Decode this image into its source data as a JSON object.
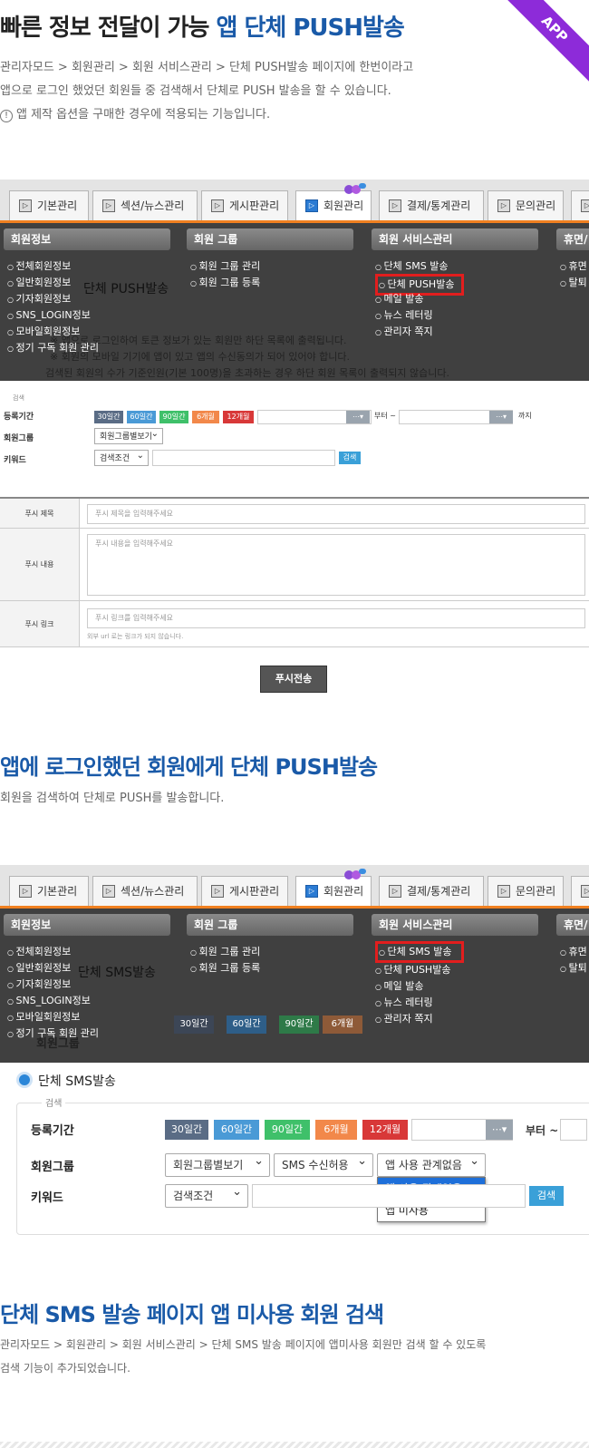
{
  "badge": "APP",
  "section1": {
    "title_plain": "빠른 정보 전달이 가능 ",
    "title_highlight": "앱 단체 PUSH발송",
    "desc_line1": "관리자모드 > 회원관리 > 회원 서비스관리 > 단체 PUSH발송 페이지에 한번이라고",
    "desc_line2": "앱으로 로그인 했었던 회원들 중 검색해서 단체로 PUSH 발송을 할 수 있습니다.",
    "notice_icon": "!",
    "desc_line3": "앱 제작 옵션을 구매한 경우에 적용되는 기능입니다."
  },
  "tabs": [
    "기본관리",
    "섹션/뉴스관리",
    "게시판관리",
    "회원관리",
    "결제/통계관리",
    "문의관리"
  ],
  "menu": {
    "group1": {
      "title": "회원정보",
      "items": [
        "전체회원정보",
        "일반회원정보",
        "기자회원정보",
        "SNS_LOGIN정보",
        "모바일회원정보",
        "정기 구독 회원 관리"
      ]
    },
    "group2": {
      "title": "회원 그룹",
      "items": [
        "회원 그룹 관리",
        "회원 그룹 등록"
      ]
    },
    "group3": {
      "title": "회원 서비스관리",
      "items": [
        "단체 SMS 발송",
        "단체 PUSH발송",
        "메일 발송",
        "뉴스 레터링",
        "관리자 쪽지"
      ]
    },
    "group4": {
      "title": "휴면/",
      "items": [
        "휴면",
        "탈퇴"
      ]
    }
  },
  "shot1": {
    "ghost_page_title": "단체 PUSH발송",
    "ghost_line1": "※ 앱으로 로그인하여 토큰 정보가 있는 회원만 하단 목록에 출력됩니다.",
    "ghost_line2": "※ 회원의 모바일 기기에 앱이 있고 앱의 수신동의가 되어 있어야 합니다.",
    "ghost_line3": "검색된 회원의 수가 기준인원(기본 100명)을 초과하는 경우 하단 회원 목록이 출력되지 않습니다.",
    "search": {
      "legend": "검색",
      "period_label": "등록기간",
      "periods": [
        "30일간",
        "60일간",
        "90일간",
        "6개월",
        "12개월"
      ],
      "from": "부터 ~",
      "to": "까지",
      "group_label": "회원그룹",
      "group_select": "회원그룹별보기",
      "keyword_label": "키워드",
      "keyword_select": "검색조건",
      "search_button": "검색"
    },
    "form": {
      "title_label": "푸시 제목",
      "title_placeholder": "푸시 제목을 입력해주세요",
      "content_label": "푸시 내용",
      "content_placeholder": "푸시 내용을 입력해주세요",
      "link_label": "푸시 링크",
      "link_placeholder": "푸시 링크를 입력해주세요",
      "link_note": "외부 url 로는 링크가 되지 않습니다."
    },
    "send_button": "푸시전송"
  },
  "section2": {
    "title": "앱에 로그인했던 회원에게 단체 PUSH발송",
    "desc": "회원을 검색하여 단체로 PUSH를 발송합니다."
  },
  "shot2": {
    "ghost_page_title": "단체 SMS발송",
    "page_title": "단체 SMS발송",
    "search": {
      "legend": "검색",
      "period_label": "등록기간",
      "periods": [
        "30일간",
        "60일간",
        "90일간",
        "6개월",
        "12개월"
      ],
      "from": "부터 ~",
      "group_label": "회원그룹",
      "group_select": "회원그룹별보기",
      "sms_select": "SMS 수신허용",
      "app_select": "앱 사용 관계없음",
      "app_options": [
        "앱 사용 관계없음",
        "앱 미사용"
      ],
      "keyword_label": "키워드",
      "keyword_select": "검색조건",
      "search_button": "검색"
    }
  },
  "section3": {
    "title": "단체 SMS 발송 페이지 앱 미사용 회원 검색",
    "desc_line1": "관리자모드 > 회원관리 > 회원 서비스관리 > 단체 SMS 발송 페이지에 앱미사용 회원만 검색 할 수 있도록",
    "desc_line2": "검색 기능이 추가되었습니다."
  },
  "colors": {
    "accent_blue": "#1a5aa8",
    "tab_orange": "#f08020",
    "highlight_red": "#e21e1e",
    "ribbon_purple": "#8d2bd9",
    "btn_30": "#5a6c85",
    "btn_60": "#4a9ad6",
    "btn_90": "#3fc06a",
    "btn_6m": "#f2884a",
    "btn_12m": "#d83838"
  }
}
